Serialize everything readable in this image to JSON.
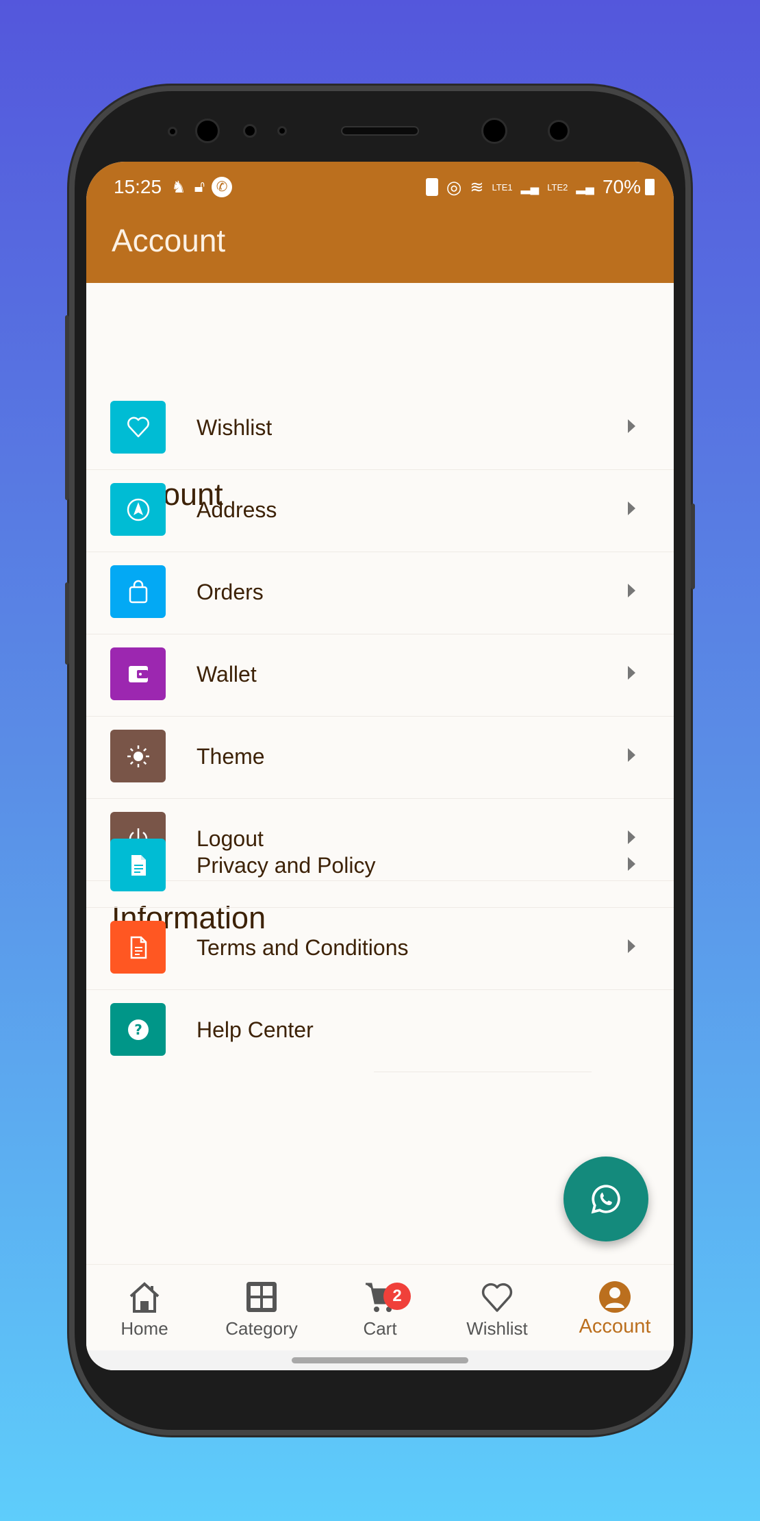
{
  "status_bar": {
    "time": "15:25",
    "battery": "70%",
    "sim1": "LTE1",
    "sim2": "LTE2"
  },
  "app_bar": {
    "title": "Account",
    "color": "#bb6f1e"
  },
  "sections": [
    {
      "title": "Account",
      "items": [
        {
          "label": "Wishlist",
          "icon": "heart-icon",
          "color": "#00bcd4"
        },
        {
          "label": "Address",
          "icon": "navigation-icon",
          "color": "#00bcd4"
        },
        {
          "label": "Orders",
          "icon": "shopping-bag-icon",
          "color": "#03a9f4"
        },
        {
          "label": "Wallet",
          "icon": "wallet-icon",
          "color": "#9c27b0"
        },
        {
          "label": "Theme",
          "icon": "sun-icon",
          "color": "#795548"
        },
        {
          "label": "Logout",
          "icon": "power-icon",
          "color": "#795548"
        }
      ]
    },
    {
      "title": "Information",
      "items": [
        {
          "label": "Privacy and Policy",
          "icon": "document-icon",
          "color": "#00bcd4"
        },
        {
          "label": "Terms and Conditions",
          "icon": "document-outline-icon",
          "color": "#ff5722"
        },
        {
          "label": "Help Center",
          "icon": "help-icon",
          "color": "#009688"
        }
      ]
    }
  ],
  "fab": {
    "icon": "whatsapp-icon",
    "color": "#148a7c"
  },
  "bottom_nav": {
    "active": "Account",
    "items": [
      {
        "label": "Home",
        "icon": "home-icon"
      },
      {
        "label": "Category",
        "icon": "grid-icon"
      },
      {
        "label": "Cart",
        "icon": "cart-icon",
        "badge": "2"
      },
      {
        "label": "Wishlist",
        "icon": "heart-icon"
      },
      {
        "label": "Account",
        "icon": "account-icon"
      }
    ]
  }
}
